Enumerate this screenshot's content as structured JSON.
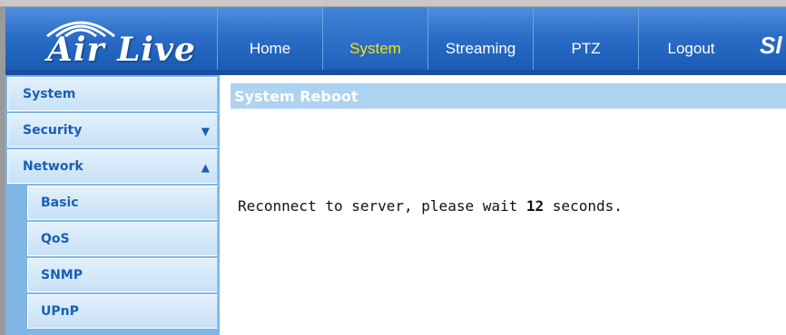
{
  "header": {
    "logo_text": "Air Live",
    "nav": [
      {
        "label": "Home",
        "active": false
      },
      {
        "label": "System",
        "active": true
      },
      {
        "label": "Streaming",
        "active": false
      },
      {
        "label": "PTZ",
        "active": false
      },
      {
        "label": "Logout",
        "active": false
      }
    ],
    "nav_overflow_text": "Sl"
  },
  "sidebar": {
    "items": [
      {
        "label": "System",
        "arrow": ""
      },
      {
        "label": "Security",
        "arrow": "▼"
      },
      {
        "label": "Network",
        "arrow": "▲"
      },
      {
        "label": "Basic",
        "arrow": ""
      },
      {
        "label": "QoS",
        "arrow": ""
      },
      {
        "label": "SNMP",
        "arrow": ""
      },
      {
        "label": "UPnP",
        "arrow": ""
      }
    ]
  },
  "main": {
    "section_title": "System Reboot",
    "message_prefix": "Reconnect to server, please wait ",
    "countdown": "12",
    "message_suffix": " seconds."
  },
  "colors": {
    "header_blue": "#2a6cc6",
    "active_tab_text": "#f5e400",
    "sidebar_text": "#1a5fb4",
    "section_title_bg": "#aed3f1"
  }
}
